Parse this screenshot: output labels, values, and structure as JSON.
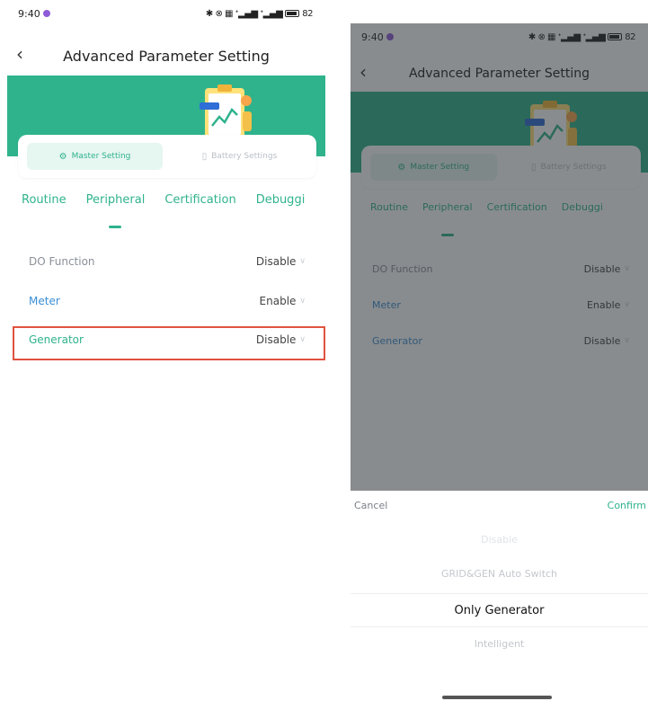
{
  "status": {
    "time": "9:40",
    "right_text": "✱ ⊗ ▦ ᐩ▂▄▆ ᐩ▂▄▆",
    "battery": "82"
  },
  "header": {
    "title": "Advanced Parameter Setting"
  },
  "main_tabs": [
    {
      "label": "Master Setting",
      "icon": "gear-icon"
    },
    {
      "label": "Battery Settings",
      "icon": "battery-icon"
    }
  ],
  "sub_tabs": [
    "Routine",
    "Peripheral",
    "Certification",
    "Debuggi"
  ],
  "rows": [
    {
      "label": "DO Function",
      "value": "Disable"
    },
    {
      "label": "Meter",
      "value": "Enable"
    },
    {
      "label": "Generator",
      "value": "Disable"
    }
  ],
  "picker": {
    "cancel": "Cancel",
    "confirm": "Confirm",
    "options": [
      "Disable",
      "GRID&GEN Auto Switch",
      "Only Generator",
      "Intelligent"
    ],
    "selected_index": 2
  },
  "colors": {
    "brand": "#2fb38d",
    "highlight": "#e0533f"
  }
}
